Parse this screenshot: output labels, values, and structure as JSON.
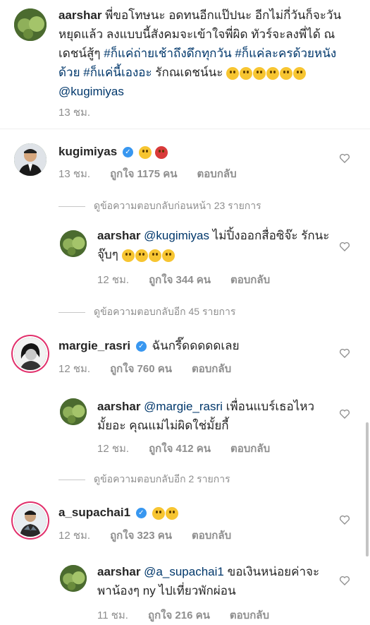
{
  "caption": {
    "username": "aarshar",
    "text_a": "พี่ขอโทษนะ อดทนอีกแป๊ปนะ อีกไม่กี่วันก็จะวันหยุดแล้ว ลงแบบนี้สังคมจะเข้าใจพี่ผิด ทัวร์จะลงพี่ได้ ณเดชน์สู้ๆ ",
    "hashtags": "#ก็แค่ถ่ายเช้าถึงดึกทุกวัน #ก็แค่ละครด้วยหนังด้วย #ก็แค่นี้เองอะ",
    "text_b": " รักณเดชน์นะ ",
    "mention": "@kugimiyas",
    "time": "13 ชม."
  },
  "comments": [
    {
      "username": "kugimiyas",
      "verified": true,
      "time": "13 ชม.",
      "likes": "ถูกใจ 1175 คน",
      "reply": "ตอบกลับ",
      "view_more": "ดูข้อความตอบกลับก่อนหน้า 23 รายการ"
    },
    {
      "username": "aarshar",
      "mention": "@kugimiyas",
      "text": " ไม่ปิ้งออกสื่อซิจ๊ะ รักนะจุ๊บๆ",
      "time": "12 ชม.",
      "likes": "ถูกใจ 344 คน",
      "reply": "ตอบกลับ",
      "view_more": "ดูข้อความตอบกลับอีก 45 รายการ"
    },
    {
      "username": "margie_rasri",
      "verified": true,
      "text": "ฉันกรี๊ดดดดดเลย",
      "time": "12 ชม.",
      "likes": "ถูกใจ 760 คน",
      "reply": "ตอบกลับ"
    },
    {
      "username": "aarshar",
      "mention": "@margie_rasri",
      "text": " เพื่อนแบร์เธอไหวมั้ยอะ คุณแม่ไม่ผิดใช่มั้ยกี้",
      "time": "12 ชม.",
      "likes": "ถูกใจ 412 คน",
      "reply": "ตอบกลับ",
      "view_more": "ดูข้อความตอบกลับอีก 2 รายการ"
    },
    {
      "username": "a_supachai1",
      "verified": true,
      "time": "12 ชม.",
      "likes": "ถูกใจ 323 คน",
      "reply": "ตอบกลับ"
    },
    {
      "username": "aarshar",
      "mention": "@a_supachai1",
      "text": " ขอเงินหน่อยค่าจะพาน้องๆ ny ไปเที่ยวพักผ่อน",
      "time": "11 ชม.",
      "likes": "ถูกใจ 216 คน",
      "reply": "ตอบกลับ"
    }
  ],
  "colors": {
    "link": "#00376b",
    "meta": "#8e8e8e",
    "verified": "#3897f0",
    "story_ring": "#e1306c"
  }
}
